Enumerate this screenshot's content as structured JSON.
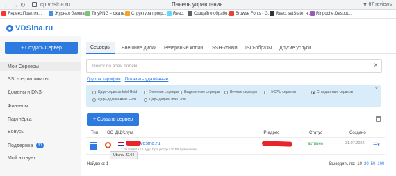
{
  "browser": {
    "url": "cp.vdsina.ru",
    "tab_title": "Панель управления",
    "extension_rating": "★ 67 reviews",
    "bookmarks": [
      {
        "label": "Яндекс.Практик...",
        "color": "#ff3333"
      },
      {
        "label": "Журнал безопас...",
        "color": "#4a90e2"
      },
      {
        "label": "TinyPNG – сжать...",
        "color": "#7cc576"
      },
      {
        "label": "Структура прогр...",
        "color": "#f5a623"
      },
      {
        "label": "React",
        "color": "#61dafb"
      },
      {
        "label": "Создайте обрабо...",
        "color": "#5f6368"
      },
      {
        "label": "Browse Fonts - G...",
        "color": "#ea4335"
      },
      {
        "label": "React setState: н...",
        "color": "#333333"
      },
      {
        "label": "Rinpoche,Despot...",
        "color": "#9b59b6"
      }
    ]
  },
  "logo": {
    "text": "VDSina.ru"
  },
  "sidebar": {
    "create_label": "+ Создать Сервер",
    "items": [
      {
        "label": "Мои Серверы",
        "active": true
      },
      {
        "label": "SSL-сертификаты"
      },
      {
        "label": "Домены и DNS"
      },
      {
        "label": "Финансы"
      },
      {
        "label": "Партнёрка"
      },
      {
        "label": "Бонусы"
      },
      {
        "label": "Поддержка",
        "badge": "30"
      },
      {
        "label": "Мой аккаунт"
      }
    ]
  },
  "tabs": [
    "Серверы",
    "Внешние диски",
    "Резервные копии",
    "SSH-ключи",
    "ISO-образы",
    "Другие услуги"
  ],
  "search": {
    "placeholder": "Поиск по всем полям",
    "close": "×"
  },
  "links": {
    "tariffs": "Группа тарифов",
    "show_deleted": "Показать удалённые"
  },
  "filters": {
    "close": "×",
    "options": [
      "Царь-серверы Intel Gold",
      "Эпичные серверы",
      "Выделенные серверы",
      "Вечные серверы",
      "Hi-CPU серверы",
      "Стандартные серверы",
      "Царь-дедики AMD EPYC",
      "Царь-дедики Intel Gold"
    ],
    "selected": "Стандартные серверы"
  },
  "main": {
    "create_label": "+ Создать сервер"
  },
  "table": {
    "headers": {
      "type": "Тип",
      "os": "ОС",
      "dc": "ДЦ",
      "service": "Услуга",
      "ip": "IP-адрес",
      "status": "Статус",
      "created": "Создано"
    },
    "rows": [
      {
        "name": ".vdsina.ru",
        "description": "1 ГБ Памяти / 1 ядро Процессор / 30 ГБ Хранилище",
        "tooltip": "Ubuntu 22.04",
        "status": "активно",
        "created": "31.07.2022"
      }
    ]
  },
  "footer": {
    "found": "Найдено: 1",
    "per_page_label": "Выводить по:",
    "per_page": [
      "10",
      "20",
      "50",
      "100"
    ],
    "per_page_current": "10"
  }
}
